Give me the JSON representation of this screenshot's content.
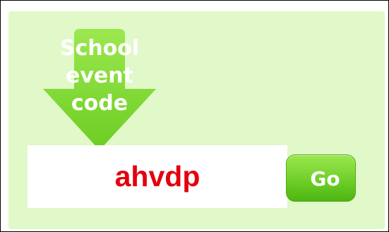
{
  "prompt": {
    "lines": [
      "School",
      "event",
      "code"
    ]
  },
  "code_field": {
    "value": "ahvdp"
  },
  "go_button": {
    "label": "Go"
  },
  "colors": {
    "panel_background": "#e1f8c8",
    "arrow_green": "#8ee034",
    "code_text": "#e3000f",
    "button_green": "#6fcf28"
  }
}
